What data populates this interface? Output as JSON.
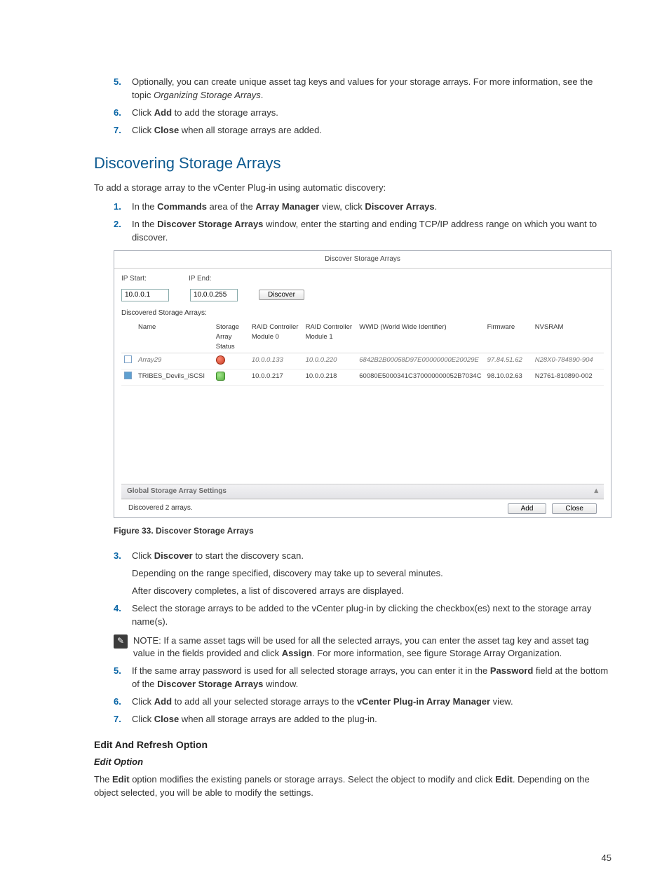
{
  "topList": [
    {
      "n": "5.",
      "html": [
        "Optionally, you can create unique asset tag keys and values for your storage arrays. For more information, see the topic ",
        {
          "i": "Organizing Storage Arrays"
        },
        "."
      ]
    },
    {
      "n": "6.",
      "html": [
        "Click ",
        {
          "b": "Add"
        },
        " to add the storage arrays."
      ]
    },
    {
      "n": "7.",
      "html": [
        "Click ",
        {
          "b": "Close"
        },
        " when all storage arrays are added."
      ]
    }
  ],
  "h2": "Discovering Storage Arrays",
  "lead": "To add a storage array to the vCenter Plug-in using automatic discovery:",
  "list2a": [
    {
      "n": "1.",
      "html": [
        "In the ",
        {
          "b": "Commands"
        },
        " area of the ",
        {
          "b": "Array Manager"
        },
        " view, click ",
        {
          "b": "Discover Arrays"
        },
        "."
      ]
    },
    {
      "n": "2.",
      "html": [
        "In the ",
        {
          "b": "Discover Storage Arrays"
        },
        " window, enter the starting and ending TCP/IP address range on which you want to discover."
      ]
    }
  ],
  "fig": {
    "title": "Discover Storage Arrays",
    "ipStartLbl": "IP Start:",
    "ipEndLbl": "IP End:",
    "ipStart": "10.0.0.1",
    "ipEnd": "10.0.0.255",
    "discover": "Discover",
    "tblLbl": "Discovered Storage Arrays:",
    "cols": [
      "",
      "Name",
      "Storage Array Status",
      "RAID Controller Module 0",
      "RAID Controller Module 1",
      "WWID (World Wide Identifier)",
      "Firmware",
      "NVSRAM"
    ],
    "rows": [
      {
        "sel": false,
        "dim": true,
        "name": "Array29",
        "status": "red",
        "c0": "10.0.0.133",
        "c1": "10.0.0.220",
        "wwid": "6842B2B00058D97E00000000E20029E",
        "fw": "97.84.51.62",
        "nv": "N28X0-784890-904"
      },
      {
        "sel": true,
        "dim": false,
        "name": "TRIBES_Devils_iSCSI",
        "status": "green",
        "c0": "10.0.0.217",
        "c1": "10.0.0.218",
        "wwid": "60080E5000341C370000000052B7034C",
        "fw": "98.10.02.63",
        "nv": "N2761-810890-002"
      }
    ],
    "globalBar": "Global Storage Array Settings",
    "statusLine": "Discovered 2 arrays.",
    "addBtn": "Add",
    "closeBtn": "Close"
  },
  "figCaption": "Figure 33. Discover Storage Arrays",
  "list2b1": [
    {
      "n": "3.",
      "paras": [
        [
          "Click ",
          {
            "b": "Discover"
          },
          " to start the discovery scan."
        ],
        [
          "Depending on the range specified, discovery may take up to several minutes."
        ],
        [
          "After discovery completes, a list of discovered arrays are displayed."
        ]
      ]
    },
    {
      "n": "4.",
      "paras": [
        [
          "Select the storage arrays to be added to the vCenter plug-in by clicking the checkbox(es) next to the storage array name(s)."
        ]
      ]
    }
  ],
  "note": [
    "NOTE: ",
    "If a same asset tags will be used for all the selected arrays, you can enter the asset tag key and asset tag value in the fields provided and click ",
    {
      "b": "Assign"
    },
    ". For more information, see figure Storage Array Organization."
  ],
  "list2b2": [
    {
      "n": "5.",
      "html": [
        "If the same array password is used for all selected storage arrays, you can enter it in the ",
        {
          "b": "Password"
        },
        " field at the bottom of the ",
        {
          "b": "Discover Storage Arrays"
        },
        " window."
      ]
    },
    {
      "n": "6.",
      "html": [
        "Click ",
        {
          "b": "Add"
        },
        " to add all your selected storage arrays to the ",
        {
          "b": "vCenter Plug-in Array Manager"
        },
        " view."
      ]
    },
    {
      "n": "7.",
      "html": [
        "Click ",
        {
          "b": "Close"
        },
        " when all storage arrays are added to the plug-in."
      ]
    }
  ],
  "h3": "Edit And Refresh Option",
  "h4": "Edit Option",
  "editPara": [
    "The ",
    {
      "b": "Edit"
    },
    " option modifies the existing panels or storage arrays. Select the object to modify and click ",
    {
      "b": "Edit"
    },
    ". Depending on the object selected, you will be able to modify the settings."
  ],
  "pageNum": "45"
}
